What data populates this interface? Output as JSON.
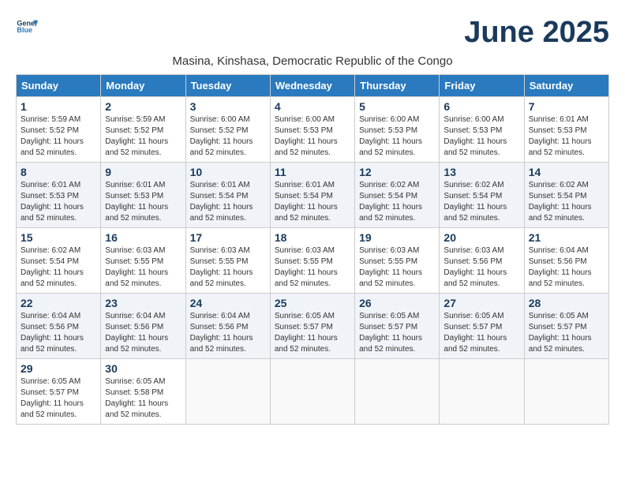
{
  "header": {
    "logo_line1": "General",
    "logo_line2": "Blue",
    "month_title": "June 2025",
    "subtitle": "Masina, Kinshasa, Democratic Republic of the Congo"
  },
  "days_of_week": [
    "Sunday",
    "Monday",
    "Tuesday",
    "Wednesday",
    "Thursday",
    "Friday",
    "Saturday"
  ],
  "weeks": [
    [
      {
        "day": "1",
        "sunrise": "5:59 AM",
        "sunset": "5:52 PM",
        "daylight": "11 hours and 52 minutes."
      },
      {
        "day": "2",
        "sunrise": "5:59 AM",
        "sunset": "5:52 PM",
        "daylight": "11 hours and 52 minutes."
      },
      {
        "day": "3",
        "sunrise": "6:00 AM",
        "sunset": "5:52 PM",
        "daylight": "11 hours and 52 minutes."
      },
      {
        "day": "4",
        "sunrise": "6:00 AM",
        "sunset": "5:53 PM",
        "daylight": "11 hours and 52 minutes."
      },
      {
        "day": "5",
        "sunrise": "6:00 AM",
        "sunset": "5:53 PM",
        "daylight": "11 hours and 52 minutes."
      },
      {
        "day": "6",
        "sunrise": "6:00 AM",
        "sunset": "5:53 PM",
        "daylight": "11 hours and 52 minutes."
      },
      {
        "day": "7",
        "sunrise": "6:01 AM",
        "sunset": "5:53 PM",
        "daylight": "11 hours and 52 minutes."
      }
    ],
    [
      {
        "day": "8",
        "sunrise": "6:01 AM",
        "sunset": "5:53 PM",
        "daylight": "11 hours and 52 minutes."
      },
      {
        "day": "9",
        "sunrise": "6:01 AM",
        "sunset": "5:53 PM",
        "daylight": "11 hours and 52 minutes."
      },
      {
        "day": "10",
        "sunrise": "6:01 AM",
        "sunset": "5:54 PM",
        "daylight": "11 hours and 52 minutes."
      },
      {
        "day": "11",
        "sunrise": "6:01 AM",
        "sunset": "5:54 PM",
        "daylight": "11 hours and 52 minutes."
      },
      {
        "day": "12",
        "sunrise": "6:02 AM",
        "sunset": "5:54 PM",
        "daylight": "11 hours and 52 minutes."
      },
      {
        "day": "13",
        "sunrise": "6:02 AM",
        "sunset": "5:54 PM",
        "daylight": "11 hours and 52 minutes."
      },
      {
        "day": "14",
        "sunrise": "6:02 AM",
        "sunset": "5:54 PM",
        "daylight": "11 hours and 52 minutes."
      }
    ],
    [
      {
        "day": "15",
        "sunrise": "6:02 AM",
        "sunset": "5:54 PM",
        "daylight": "11 hours and 52 minutes."
      },
      {
        "day": "16",
        "sunrise": "6:03 AM",
        "sunset": "5:55 PM",
        "daylight": "11 hours and 52 minutes."
      },
      {
        "day": "17",
        "sunrise": "6:03 AM",
        "sunset": "5:55 PM",
        "daylight": "11 hours and 52 minutes."
      },
      {
        "day": "18",
        "sunrise": "6:03 AM",
        "sunset": "5:55 PM",
        "daylight": "11 hours and 52 minutes."
      },
      {
        "day": "19",
        "sunrise": "6:03 AM",
        "sunset": "5:55 PM",
        "daylight": "11 hours and 52 minutes."
      },
      {
        "day": "20",
        "sunrise": "6:03 AM",
        "sunset": "5:56 PM",
        "daylight": "11 hours and 52 minutes."
      },
      {
        "day": "21",
        "sunrise": "6:04 AM",
        "sunset": "5:56 PM",
        "daylight": "11 hours and 52 minutes."
      }
    ],
    [
      {
        "day": "22",
        "sunrise": "6:04 AM",
        "sunset": "5:56 PM",
        "daylight": "11 hours and 52 minutes."
      },
      {
        "day": "23",
        "sunrise": "6:04 AM",
        "sunset": "5:56 PM",
        "daylight": "11 hours and 52 minutes."
      },
      {
        "day": "24",
        "sunrise": "6:04 AM",
        "sunset": "5:56 PM",
        "daylight": "11 hours and 52 minutes."
      },
      {
        "day": "25",
        "sunrise": "6:05 AM",
        "sunset": "5:57 PM",
        "daylight": "11 hours and 52 minutes."
      },
      {
        "day": "26",
        "sunrise": "6:05 AM",
        "sunset": "5:57 PM",
        "daylight": "11 hours and 52 minutes."
      },
      {
        "day": "27",
        "sunrise": "6:05 AM",
        "sunset": "5:57 PM",
        "daylight": "11 hours and 52 minutes."
      },
      {
        "day": "28",
        "sunrise": "6:05 AM",
        "sunset": "5:57 PM",
        "daylight": "11 hours and 52 minutes."
      }
    ],
    [
      {
        "day": "29",
        "sunrise": "6:05 AM",
        "sunset": "5:57 PM",
        "daylight": "11 hours and 52 minutes."
      },
      {
        "day": "30",
        "sunrise": "6:05 AM",
        "sunset": "5:58 PM",
        "daylight": "11 hours and 52 minutes."
      },
      null,
      null,
      null,
      null,
      null
    ]
  ]
}
